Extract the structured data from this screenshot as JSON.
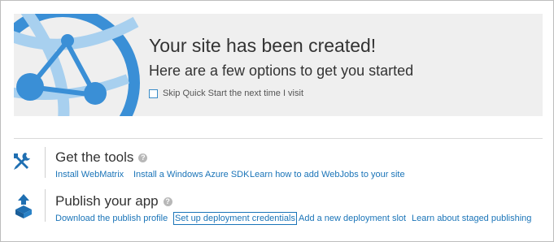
{
  "banner": {
    "title": "Your site has been created!",
    "subtitle": "Here are a few options to get you started",
    "skip_label": "Skip Quick Start the next time I visit",
    "skip_checked": false,
    "globe_icon": "azure-globe-logo",
    "colors": {
      "background": "#efefef",
      "globe_dark": "#3a8fd6",
      "globe_light": "#a8d0ef"
    }
  },
  "sections": [
    {
      "title": "Get the tools",
      "icon": "tools-icon",
      "links": [
        "Install WebMatrix",
        "Install a Windows Azure SDK",
        "Learn how to add WebJobs to your site"
      ]
    },
    {
      "title": "Publish your app",
      "icon": "publish-icon",
      "links": [
        "Download the publish profile",
        "Set up deployment credentials",
        "Add a new deployment slot",
        "Learn about staged publishing"
      ]
    }
  ],
  "help_glyph": "?",
  "colors": {
    "link": "#1a74b8",
    "text": "#333333",
    "icon": "#1f6fb2"
  }
}
